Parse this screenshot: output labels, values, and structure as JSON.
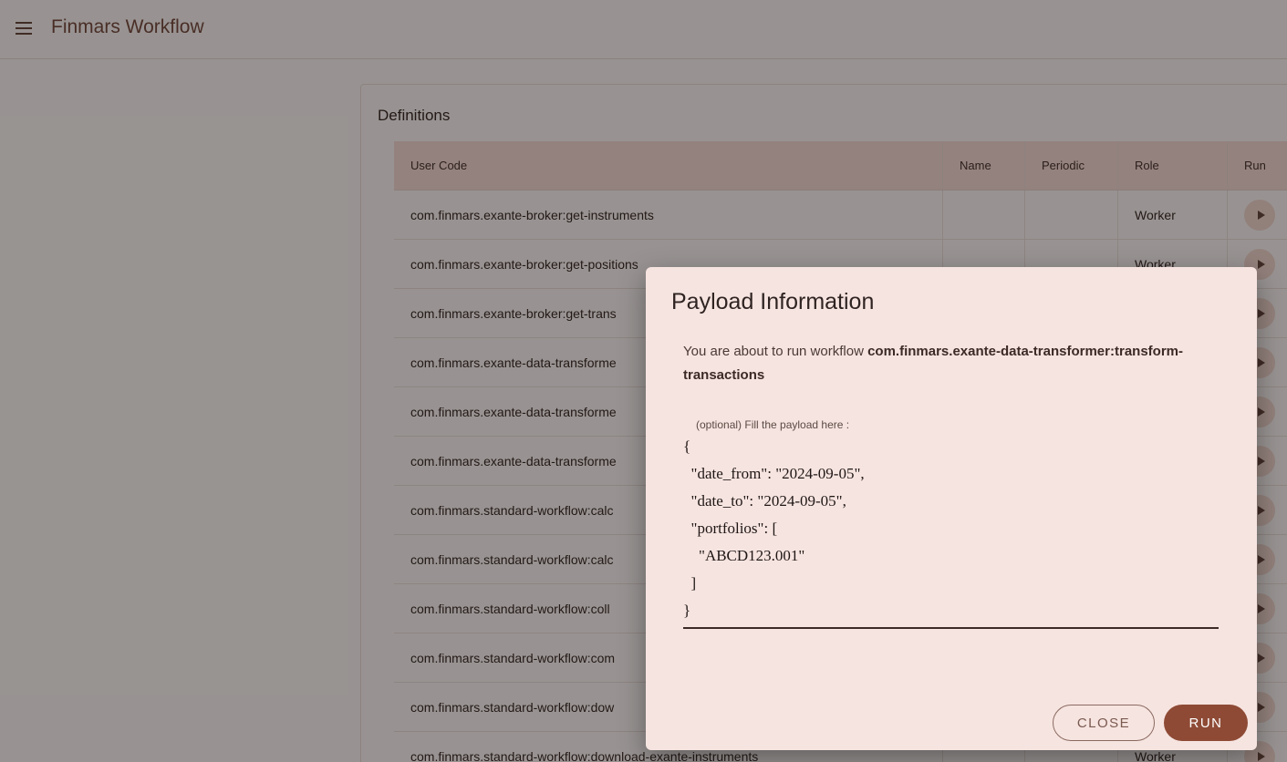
{
  "app": {
    "title": "Finmars Workflow"
  },
  "definitions": {
    "title": "Definitions",
    "columns": [
      "User Code",
      "Name",
      "Periodic",
      "Role",
      "Run"
    ],
    "rows": [
      {
        "user_code": "com.finmars.exante-broker:get-instruments",
        "name": "",
        "periodic": "",
        "role": "Worker"
      },
      {
        "user_code": "com.finmars.exante-broker:get-positions",
        "name": "",
        "periodic": "",
        "role": "Worker"
      },
      {
        "user_code": "com.finmars.exante-broker:get-trans",
        "name": "",
        "periodic": "",
        "role": ""
      },
      {
        "user_code": "com.finmars.exante-data-transforme",
        "name": "",
        "periodic": "",
        "role": ""
      },
      {
        "user_code": "com.finmars.exante-data-transforme",
        "name": "",
        "periodic": "",
        "role": ""
      },
      {
        "user_code": "com.finmars.exante-data-transforme",
        "name": "",
        "periodic": "",
        "role": ""
      },
      {
        "user_code": "com.finmars.standard-workflow:calc",
        "name": "",
        "periodic": "",
        "role": ""
      },
      {
        "user_code": "com.finmars.standard-workflow:calc",
        "name": "",
        "periodic": "",
        "role": ""
      },
      {
        "user_code": "com.finmars.standard-workflow:coll",
        "name": "",
        "periodic": "",
        "role": ""
      },
      {
        "user_code": "com.finmars.standard-workflow:com",
        "name": "",
        "periodic": "",
        "role": ""
      },
      {
        "user_code": "com.finmars.standard-workflow:dow",
        "name": "",
        "periodic": "",
        "role": ""
      },
      {
        "user_code": "com.finmars.standard-workflow:download-exante-instruments",
        "name": "",
        "periodic": "",
        "role": "Worker"
      }
    ]
  },
  "dialog": {
    "title": "Payload Information",
    "message_prefix": "You are about to run workflow ",
    "workflow_code": "com.finmars.exante-data-transformer:transform-transactions",
    "payload_label": "(optional) Fill the payload here :",
    "payload_value": "{\n  \"date_from\": \"2024-09-05\",\n  \"date_to\": \"2024-09-05\",\n  \"portfolios\": [\n    \"ABCD123.001\"\n  ]\n}",
    "close_label": "CLOSE",
    "run_label": "RUN"
  },
  "colors": {
    "accent": "#8e4a35",
    "header_bg": "#f7d9d2",
    "dialog_bg": "#f6e4e0"
  },
  "icons": {
    "menu": "menu-icon",
    "run": "play-icon"
  }
}
